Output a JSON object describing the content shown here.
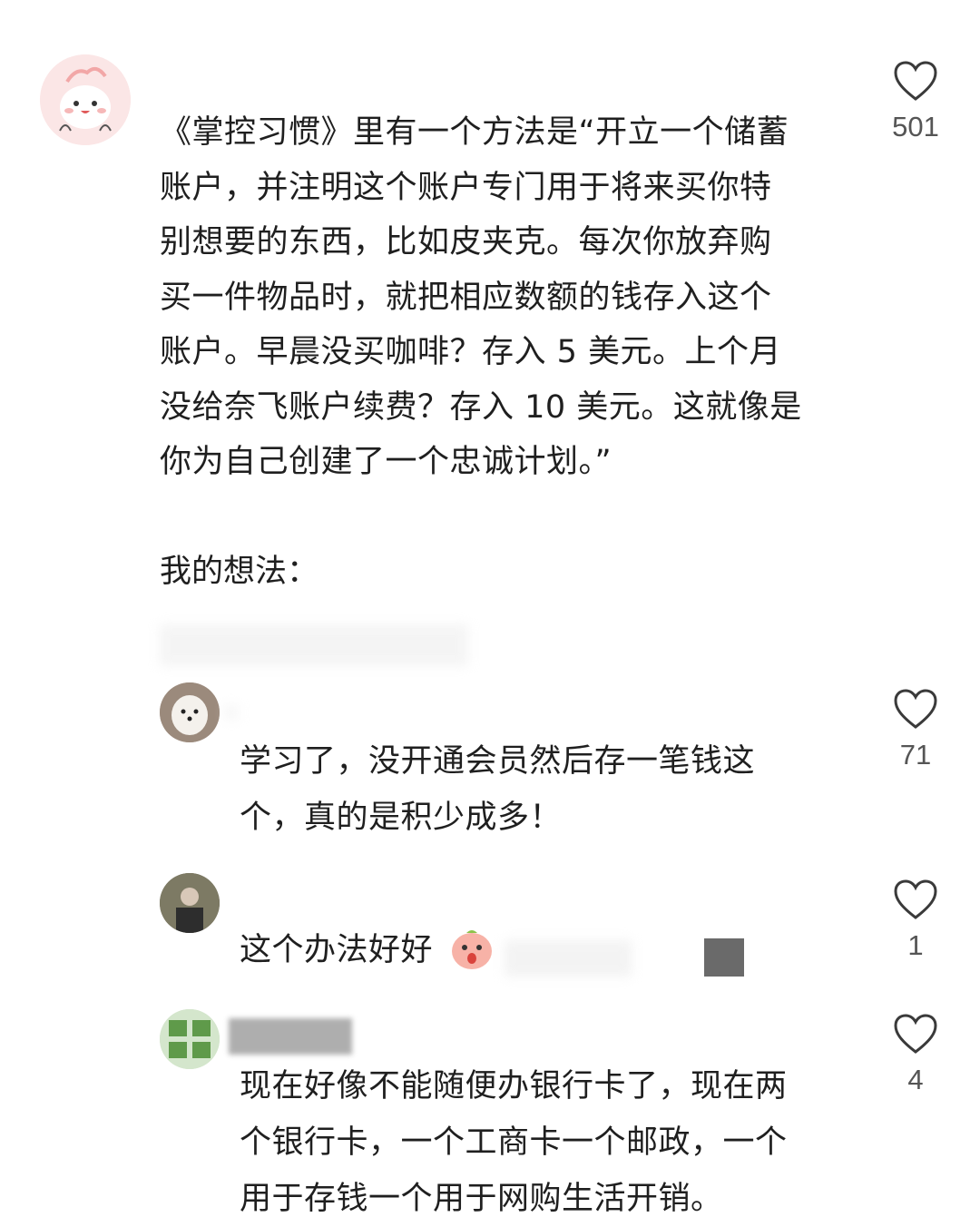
{
  "post": {
    "text": "《掌控习惯》里有一个方法是“开立一个储蓄\n账户，并注明这个账户专门用于将来买你特\n别想要的东西，比如皮夹克。每次你放弃购\n买一件物品时，就把相应数额的钱存入这个\n账户。早晨没买咖啡？存入 5 美元。上个月\n没给奈飞账户续费？存入 10 美元。这就像是\n你为自己创建了一个忠诚计划。”",
    "likes": "501",
    "thoughts_label": "我的想法："
  },
  "replies": [
    {
      "text": "学习了，没开通会员然后存一笔钱这\n个，真的是积少成多！",
      "likes": "71"
    },
    {
      "text": "这个办法好好",
      "likes": "1"
    },
    {
      "text": "现在好像不能随便办银行卡了，现在两\n个银行卡，一个工商卡一个邮政，一个\n用于存钱一个用于网购生活开销。",
      "likes": "4"
    }
  ],
  "colors": {
    "heart_stroke": "#3a3a3a",
    "avatar_pink": "#fbe6e6"
  },
  "icons": {
    "like": "heart-icon",
    "sticker": "peach-sticker"
  }
}
